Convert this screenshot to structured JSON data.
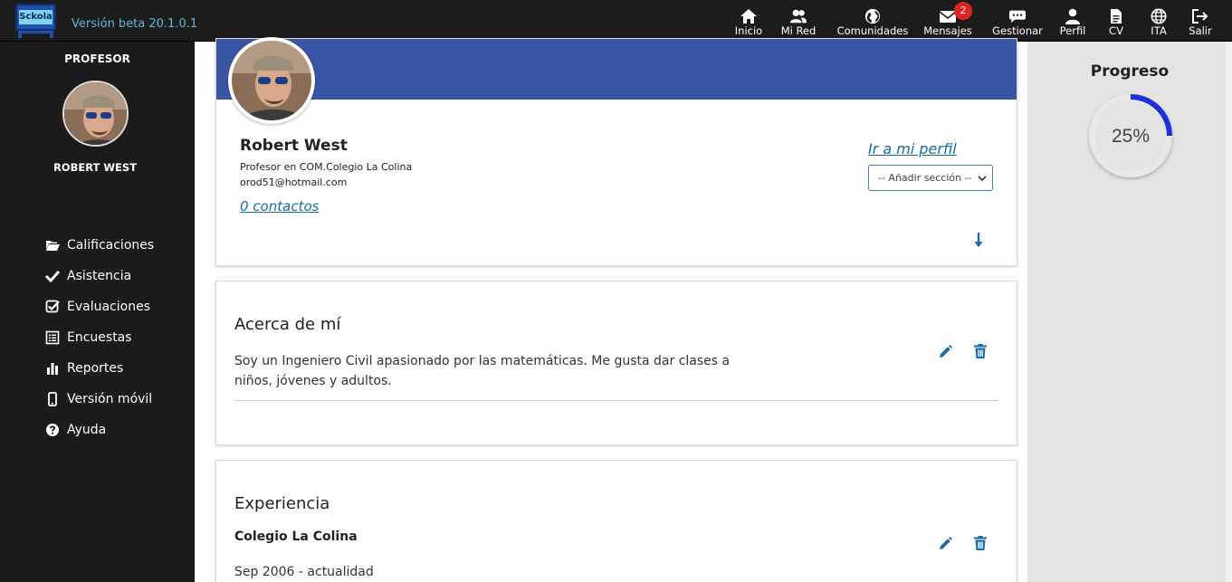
{
  "app": {
    "logo_text": "Sckola",
    "version": "Versión beta 20.1.0.1"
  },
  "nav": {
    "inicio": "Inicio",
    "mi_red": "Mi Red",
    "comunidades": "Comunidades",
    "mensajes": "Mensajes",
    "mensajes_badge": "2",
    "gestionar": "Gestionar",
    "perfil": "Perfil",
    "cv": "CV",
    "ita": "ITA",
    "salir": "Salir"
  },
  "sidebar": {
    "role": "PROFESOR",
    "user_name": "ROBERT WEST",
    "items": [
      {
        "label": "Calificaciones",
        "icon": "folder-open-icon"
      },
      {
        "label": "Asistencia",
        "icon": "check-icon"
      },
      {
        "label": "Evaluaciones",
        "icon": "check-square-icon"
      },
      {
        "label": "Encuestas",
        "icon": "list-icon"
      },
      {
        "label": "Reportes",
        "icon": "bar-chart-icon"
      },
      {
        "label": "Versión móvil",
        "icon": "mobile-icon"
      },
      {
        "label": "Ayuda",
        "icon": "question-circle-icon"
      }
    ]
  },
  "profile": {
    "name": "Robert West",
    "role_line": "Profesor en COM.Colegio La Colina",
    "email": "orod51@hotmail.com",
    "contacts": "0 contactos",
    "profile_link": "Ir a mi perfil",
    "add_section": "-- Añadir sección --"
  },
  "about": {
    "title": "Acerca de mí",
    "text": "Soy un Ingeniero Civil apasionado por las matemáticas. Me gusta dar clases a niños, jóvenes y adultos."
  },
  "experience": {
    "title": "Experiencia",
    "organization": "Colegio La Colina",
    "dates": "Sep 2006 - actualidad"
  },
  "progress": {
    "title": "Progreso",
    "value": 25,
    "label": "25%"
  },
  "colors": {
    "banner": "#3b55a5",
    "link": "#1a6aa6",
    "badge": "#e02424",
    "progress_arc": "#1a2fe0"
  }
}
